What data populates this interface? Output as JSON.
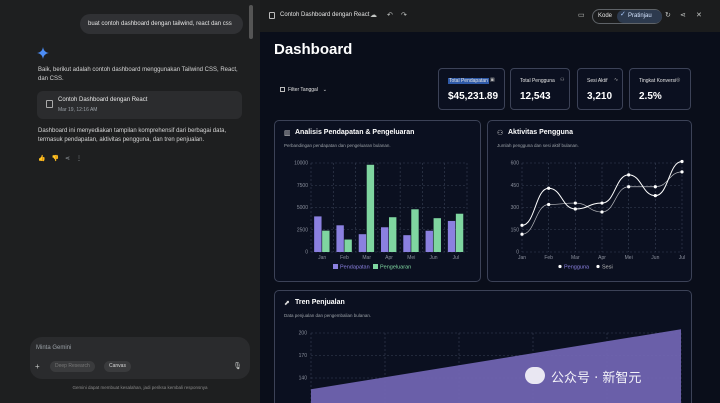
{
  "chat": {
    "user_prompt": "buat contoh dashboard dengan tailwind, react dan css",
    "reply_intro": "Baik, berikut adalah contoh dashboard menggunakan Tailwind CSS, React, dan CSS.",
    "card_title": "Contoh Dashboard dengan React",
    "card_date": "Mar 19, 12:16 AM",
    "reply_summary": "Dashboard ini menyediakan tampilan komprehensif dari berbagai data, termasuk pendapatan, aktivitas pengguna, dan tren penjualan.",
    "input_placeholder": "Minta Gemini",
    "chip_deep_research": "Deep Research",
    "chip_canvas": "Canvas",
    "disclaimer": "Gemini dapat membuat kesalahan, jadi periksa kembali responsnya"
  },
  "preview": {
    "title": "Contoh Dashboard dengan React",
    "toggle_code": "Kode",
    "toggle_preview": "Pratinjau"
  },
  "dashboard": {
    "title": "Dashboard",
    "filter_label": "Filter Tanggal",
    "stats": [
      {
        "label": "Total Pendapatan",
        "value": "$45,231.89"
      },
      {
        "label": "Total Pengguna",
        "value": "12,543"
      },
      {
        "label": "Sesi Aktif",
        "value": "3,210"
      },
      {
        "label": "Tingkat Konversi",
        "value": "2.5%"
      }
    ],
    "revenue_panel": {
      "title": "Analisis Pendapatan & Pengeluaran",
      "subtitle": "Perbandingan pendapatan dan pengeluaran bulanan."
    },
    "users_panel": {
      "title": "Aktivitas Pengguna",
      "subtitle": "Jumlah pengguna dan sesi aktif bulanan."
    },
    "sales_panel": {
      "title": "Tren Penjualan",
      "subtitle": "Data penjualan dan pengembalian bulanan."
    }
  },
  "watermark": "公众号 · 新智元",
  "colors": {
    "bar_a": "#8b80e0",
    "bar_b": "#7fd6a0",
    "area": "#7468b8",
    "line": "#ffffff"
  },
  "chart_data": [
    {
      "type": "bar",
      "categories": [
        "Jan",
        "Feb",
        "Mar",
        "Apr",
        "Mei",
        "Jun",
        "Jul"
      ],
      "series": [
        {
          "name": "Pendapatan",
          "values": [
            4000,
            3000,
            2000,
            2780,
            1890,
            2390,
            3490
          ]
        },
        {
          "name": "Pengeluaran",
          "values": [
            2400,
            1400,
            9800,
            3908,
            4800,
            3800,
            4300
          ]
        }
      ],
      "yticks": [
        "0",
        "2500",
        "5000",
        "7500",
        "10000"
      ],
      "ylim": [
        0,
        10000
      ]
    },
    {
      "type": "line",
      "categories": [
        "Jan",
        "Feb",
        "Mar",
        "Apr",
        "Mei",
        "Jun",
        "Jul"
      ],
      "series": [
        {
          "name": "Pengguna",
          "values": [
            180,
            430,
            290,
            330,
            520,
            380,
            610
          ]
        },
        {
          "name": "Sesi",
          "values": [
            120,
            320,
            330,
            270,
            440,
            440,
            540
          ]
        }
      ],
      "yticks": [
        "0",
        "150",
        "300",
        "450",
        "600"
      ],
      "ylim": [
        0,
        600
      ]
    },
    {
      "type": "area",
      "yticks": [
        "140",
        "170",
        "200"
      ],
      "x": [
        0,
        1
      ],
      "values": [
        125,
        205
      ]
    }
  ]
}
